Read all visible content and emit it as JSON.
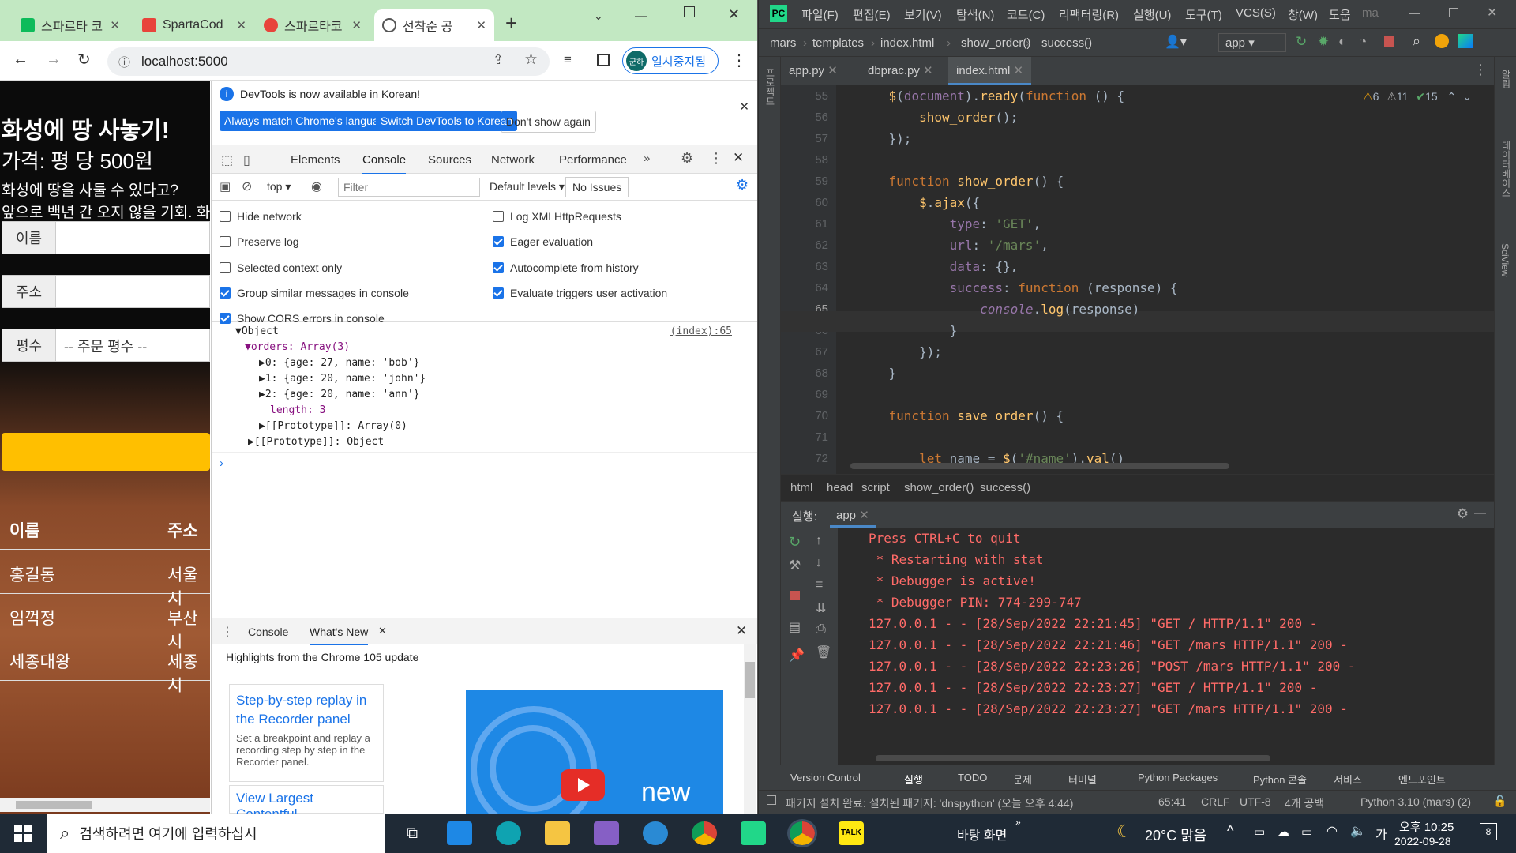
{
  "chrome": {
    "tabs": [
      {
        "label": "스파르타 코"
      },
      {
        "label": "SpartaCod"
      },
      {
        "label": "스파르타코"
      },
      {
        "label": "선착순 공"
      }
    ],
    "url": "localhost:5000",
    "profile_label": "일시중지됨",
    "profile_initial": "군하"
  },
  "page": {
    "title": "화성에 땅 사놓기!",
    "price": "가격: 평 당 500원",
    "desc1": "화성에 땅을 사둘 수 있다고?",
    "desc2": "앞으로 백년 간 오지 않을 기회. 화",
    "label_name": "이름",
    "label_address": "주소",
    "label_count": "평수",
    "count_placeholder": "-- 주문 평수 --",
    "col_name": "이름",
    "col_address": "주소",
    "rows": [
      {
        "name": "홍길동",
        "addr": "서울시"
      },
      {
        "name": "임꺽정",
        "addr": "부산시"
      },
      {
        "name": "세종대왕",
        "addr": "세종시"
      }
    ]
  },
  "devtools": {
    "banner": "DevTools is now available in Korean!",
    "btn_match": "Always match Chrome's language",
    "btn_switch": "Switch DevTools to Korean",
    "btn_dont": "Don't show again",
    "tabs": [
      "Elements",
      "Console",
      "Sources",
      "Network",
      "Performance"
    ],
    "context": "top",
    "filter_placeholder": "Filter",
    "levels": "Default levels",
    "issues": "No Issues",
    "settings_left": [
      "Hide network",
      "Preserve log",
      "Selected context only",
      "Group similar messages in console",
      "Show CORS errors in console"
    ],
    "settings_left_checked": [
      false,
      false,
      false,
      true,
      true
    ],
    "settings_right": [
      "Log XMLHttpRequests",
      "Eager evaluation",
      "Autocomplete from history",
      "Evaluate triggers user activation"
    ],
    "settings_right_checked": [
      false,
      true,
      true,
      true
    ],
    "log_source": "(index):65",
    "log_lines": [
      "▼Object",
      "▼orders: Array(3)",
      "▶0: {age: 27, name: 'bob'}",
      "▶1: {age: 20, name: 'john'}",
      "▶2: {age: 20, name: 'ann'}",
      "length: 3",
      "▶[[Prototype]]: Array(0)",
      "▶[[Prototype]]: Object"
    ],
    "drawer_tabs": [
      "Console",
      "What's New"
    ],
    "drawer_heading": "Highlights from the Chrome 105 update",
    "card1_title": "Step-by-step replay in the Recorder panel",
    "card1_body": "Set a breakpoint and replay a recording step by step in the Recorder panel.",
    "card2_title": "View Largest Contentful",
    "video_text": "new"
  },
  "ide": {
    "menu": [
      "파일(F)",
      "편집(E)",
      "보기(V)",
      "탐색(N)",
      "코드(C)",
      "리팩터링(R)",
      "실행(U)",
      "도구(T)",
      "VCS(S)",
      "창(W)",
      "도움",
      "ma"
    ],
    "breadcrumb": [
      "mars",
      "templates",
      "index.html",
      "show_order()",
      "success()"
    ],
    "run_config": "app",
    "file_tabs": [
      "app.py",
      "dbprac.py",
      "index.html"
    ],
    "inspections": {
      "warn": "6",
      "weak": "11",
      "ok": "15"
    },
    "lines": [
      55,
      56,
      57,
      58,
      59,
      60,
      61,
      62,
      63,
      64,
      65,
      66,
      67,
      68,
      69,
      70,
      71,
      72
    ],
    "path_bar": [
      "html",
      "head",
      "script",
      "show_order()",
      "success()"
    ],
    "run_label": "실행:",
    "run_tab": "app",
    "run_output": [
      "Press CTRL+C to quit",
      " * Restarting with stat",
      " * Debugger is active!",
      " * Debugger PIN: 774-299-747",
      "127.0.0.1 - - [28/Sep/2022 22:21:45] \"GET / HTTP/1.1\" 200 -",
      "127.0.0.1 - - [28/Sep/2022 22:21:46] \"GET /mars HTTP/1.1\" 200 -",
      "127.0.0.1 - - [28/Sep/2022 22:23:26] \"POST /mars HTTP/1.1\" 200 -",
      "127.0.0.1 - - [28/Sep/2022 22:23:27] \"GET / HTTP/1.1\" 200 -",
      "127.0.0.1 - - [28/Sep/2022 22:23:27] \"GET /mars HTTP/1.1\" 200 -"
    ],
    "bottom_tabs": [
      "Version Control",
      "실행",
      "TODO",
      "문제",
      "터미널",
      "Python Packages",
      "Python 콘솔",
      "서비스",
      "엔드포인트"
    ],
    "status_msg": "패키지 설치 완료: 설치된 패키지: 'dnspython' (오늘 오후 4:44)",
    "status_right": [
      "65:41",
      "CRLF",
      "UTF-8",
      "4개 공백",
      "Python 3.10 (mars) (2)"
    ],
    "left_tool": "프로젝트",
    "right_tools": [
      "알림",
      "데이터베이스",
      "SciView"
    ]
  },
  "taskbar": {
    "search_placeholder": "검색하려면 여기에 입력하십시",
    "desktop": "바탕 화면",
    "weather": "20°C 맑음",
    "ime": "가",
    "time": "오후 10:25",
    "date": "2022-09-28",
    "notif_count": "8"
  }
}
